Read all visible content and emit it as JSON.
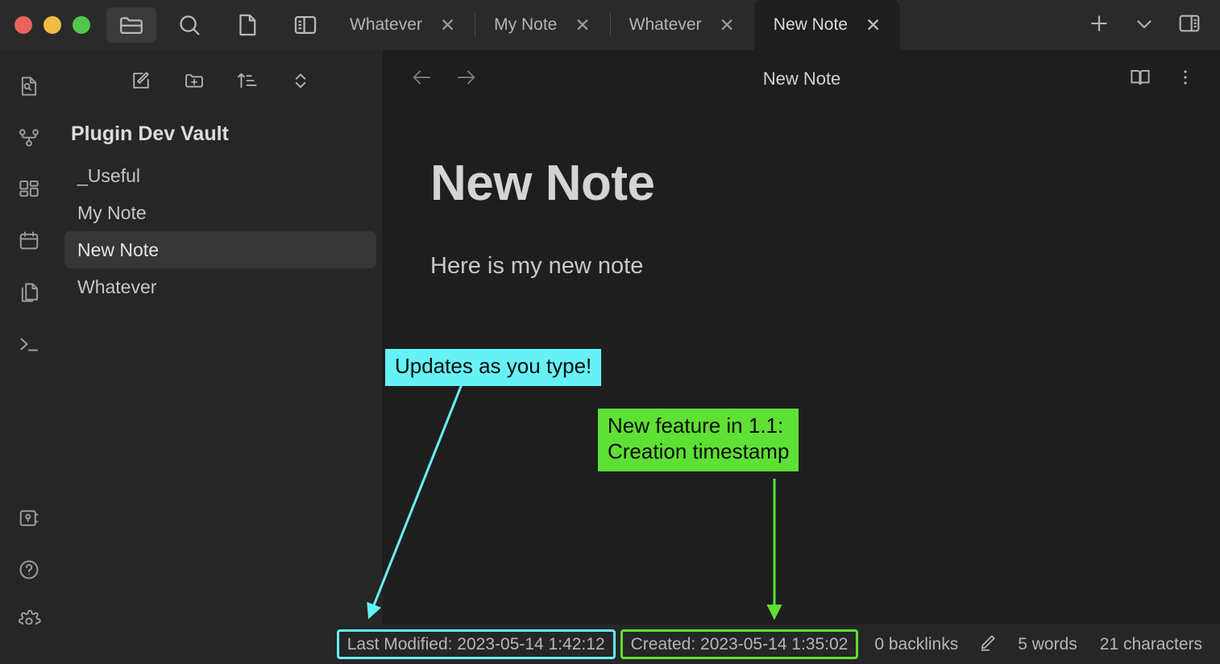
{
  "window": {
    "traffic_lights": [
      "close",
      "minimize",
      "maximize"
    ],
    "colors": {
      "close": "#e9635a",
      "minimize": "#efbc44",
      "maximize": "#53c64c",
      "sidebar_bg": "#262626",
      "editor_bg": "#1e1e1e",
      "titlebar_bg": "#2a2a2a",
      "annotation_cyan": "#66f2f5",
      "annotation_green": "#5ee034"
    },
    "titlebar_icons": [
      {
        "name": "folder-icon",
        "active": true
      },
      {
        "name": "search-icon",
        "active": false
      },
      {
        "name": "file-icon",
        "active": false
      },
      {
        "name": "sidebar-toggle-icon",
        "active": false
      }
    ]
  },
  "tabs": {
    "items": [
      {
        "label": "Whatever",
        "active": false,
        "close": "✕"
      },
      {
        "label": "My Note",
        "active": false,
        "close": "✕"
      },
      {
        "label": "Whatever",
        "active": false,
        "close": "✕"
      },
      {
        "label": "New Note",
        "active": true,
        "close": "✕"
      }
    ],
    "new_tab_label": "+",
    "tab_list_label": "∨",
    "right_sidebar_toggle": "right-sidebar-toggle"
  },
  "ribbon": {
    "top_items": [
      {
        "name": "quick-switcher-icon",
        "label": "Quick switcher"
      },
      {
        "name": "graph-view-icon",
        "label": "Graph view"
      },
      {
        "name": "canvas-icon",
        "label": "Canvas"
      },
      {
        "name": "calendar-icon",
        "label": "Calendar"
      },
      {
        "name": "templates-icon",
        "label": "Templates"
      },
      {
        "name": "terminal-icon",
        "label": "Terminal"
      }
    ],
    "bottom_items": [
      {
        "name": "vault-switcher-icon",
        "label": "Open another vault"
      },
      {
        "name": "help-icon",
        "label": "Help"
      },
      {
        "name": "settings-icon",
        "label": "Settings"
      }
    ]
  },
  "explorer": {
    "toolbar": [
      {
        "name": "new-note-icon",
        "label": "New note"
      },
      {
        "name": "new-folder-icon",
        "label": "New folder"
      },
      {
        "name": "sort-icon",
        "label": "Change sort order"
      },
      {
        "name": "collapse-icon",
        "label": "Collapse all"
      }
    ],
    "vault_title": "Plugin Dev Vault",
    "files": [
      {
        "label": "_Useful",
        "active": false
      },
      {
        "label": "My Note",
        "active": false
      },
      {
        "label": "New Note",
        "active": true
      },
      {
        "label": "Whatever",
        "active": false
      }
    ]
  },
  "editor": {
    "nav": {
      "back": "back-arrow",
      "forward": "forward-arrow"
    },
    "view_title": "New Note",
    "actions": [
      {
        "name": "reading-view-icon",
        "label": "Reading view"
      },
      {
        "name": "more-options-icon",
        "label": "More options"
      }
    ],
    "note": {
      "heading": "New Note",
      "paragraph": "Here is my new note"
    }
  },
  "statusbar": {
    "last_modified": "Last Modified: 2023-05-14 1:42:12",
    "created": "Created: 2023-05-14 1:35:02",
    "backlinks": "0 backlinks",
    "edit_icon": "pencil-icon",
    "words": "5 words",
    "characters": "21 characters"
  },
  "annotations": [
    {
      "id": "updates-annotation",
      "text": "Updates as you type!",
      "color": "#66f2f5",
      "points_to": "last-modified-status"
    },
    {
      "id": "creation-annotation",
      "text": "New feature in 1.1:\nCreation timestamp",
      "color": "#5ee034",
      "points_to": "created-status"
    }
  ]
}
